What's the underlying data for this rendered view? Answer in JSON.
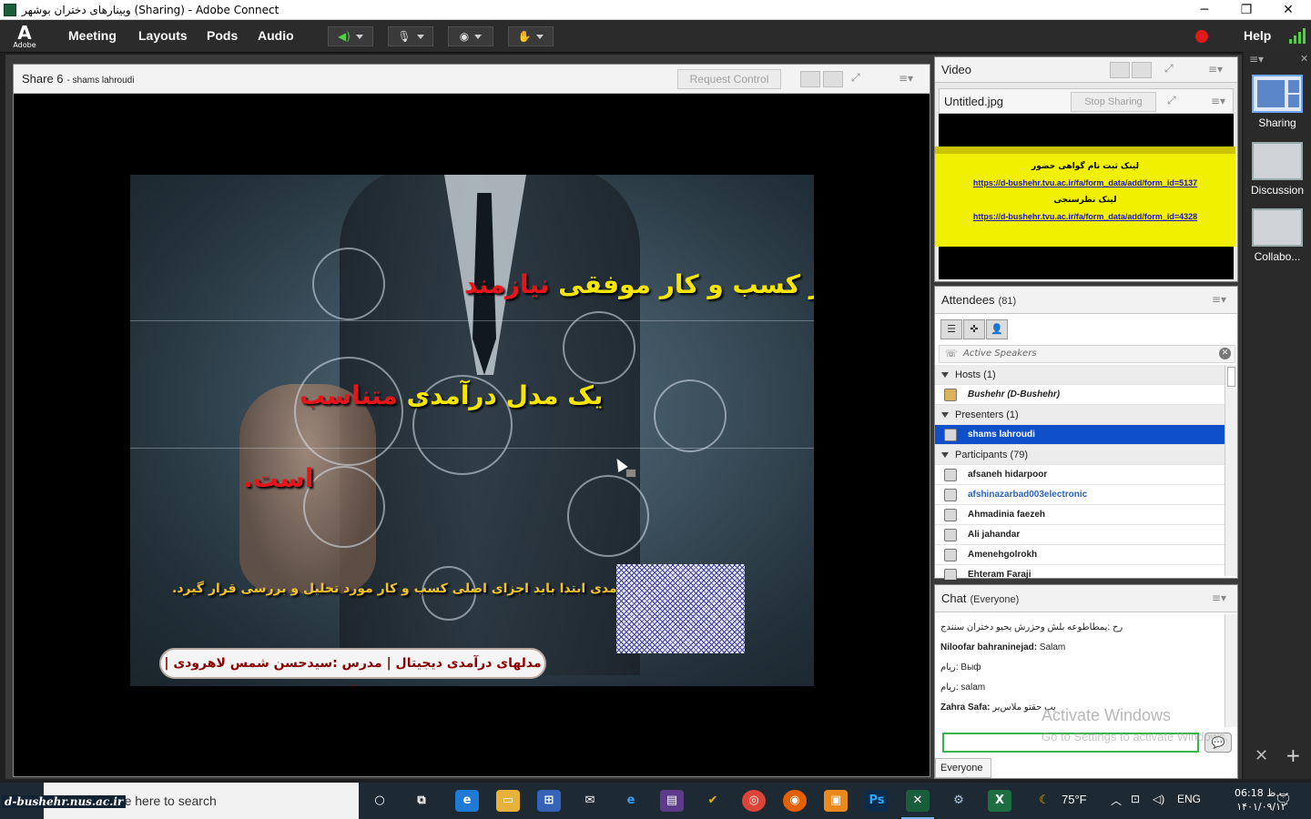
{
  "window": {
    "title": "وبینارهای دختران بوشهر (Sharing) - Adobe Connect",
    "minimize": "─",
    "maximize": "❐",
    "close": "✕"
  },
  "menubar": {
    "logo_text": "Adobe",
    "items": [
      "Meeting",
      "Layouts",
      "Pods",
      "Audio"
    ],
    "help": "Help",
    "speaker_icon": "speaker-icon",
    "mic_icon": "microphone-icon",
    "webcam_icon": "webcam-icon",
    "raise_hand_icon": "raise-hand-icon"
  },
  "share_pod": {
    "title": "Share 6",
    "presenter": "- shams lahroudi",
    "request_control": "Request Control"
  },
  "slide": {
    "line1_yellow": "هر کسب و کار موفقی",
    "line1_red": "نیازمند",
    "line2_yellow": "یک مدل درآمدی",
    "line2_red": "متناسب",
    "line3_red": "است.",
    "body": "مدل درآمدی ابتدا باید اجزای اصلی کسب و کار مورد تحلیل و بررسی قرار گیرد.",
    "footer": "مدلهای درآمدی دیجیتال | مدرس :سیدحسن شمس لاهرودی | 4"
  },
  "video_pod": {
    "title": "Video",
    "sub_title": "Untitled.jpg",
    "stop_sharing": "Stop Sharing",
    "lines": [
      "لینک ثبت نام گواهی حضور",
      "https://d-bushehr.tvu.ac.ir/fa/form_data/add/form_id=5137",
      "لینک نظرسنجی",
      "https://d-bushehr.tvu.ac.ir/fa/form_data/add/form_id=4328"
    ]
  },
  "attendees": {
    "title": "Attendees",
    "count": "(81)",
    "active_speakers": "Active Speakers",
    "groups": [
      {
        "label": "Hosts (1)",
        "members": [
          {
            "name": "Bushehr (D-Bushehr)",
            "italic": true
          }
        ]
      },
      {
        "label": "Presenters (1)",
        "members": [
          {
            "name": "shams lahroudi",
            "selected": true
          }
        ]
      },
      {
        "label": "Participants (79)",
        "members": [
          {
            "name": "afsaneh hidarpoor"
          },
          {
            "name": "afshinazarbad003electronic",
            "blue": true
          },
          {
            "name": "Ahmadinia faezeh"
          },
          {
            "name": "Ali jahandar"
          },
          {
            "name": "Amenehgolrokh"
          },
          {
            "name": "Ehteram Faraji"
          }
        ]
      }
    ]
  },
  "chat": {
    "title": "Chat",
    "scope": "(Everyone)",
    "messages": [
      {
        "sender": "",
        "text": "رح :یمطاطوعه بلش وحزرش یحیو دختران سنندج"
      },
      {
        "sender": "Niloofar bahraninejad:",
        "text": " Salam"
      },
      {
        "sender": "",
        "text": "ریام: Bыф"
      },
      {
        "sender": "",
        "text": "ریام: salam"
      },
      {
        "sender": "Zahra Safa:",
        "text": " یب حقتو ملاس‌یر"
      }
    ],
    "recipient": "Everyone",
    "watermark_title": "Activate Windows",
    "watermark_sub": "Go to Settings to activate Windows."
  },
  "layouts": {
    "items": [
      "Sharing",
      "Discussion",
      "Collabo..."
    ]
  },
  "taskbar": {
    "url_badge": "d-bushehr.nus.ac.ir",
    "search_placeholder": "Type here to search",
    "weather": "75°F",
    "language": "ENG",
    "time": "06:18 ب.ظ",
    "date": "۱۴۰۱/۰۹/۱۲"
  },
  "colors": {
    "slide_yellow": "#f7e600",
    "slide_red": "#e4161b",
    "selected_row": "#0f4fc9",
    "record_red": "#e01a1a",
    "signal_green": "#4cd33d"
  }
}
